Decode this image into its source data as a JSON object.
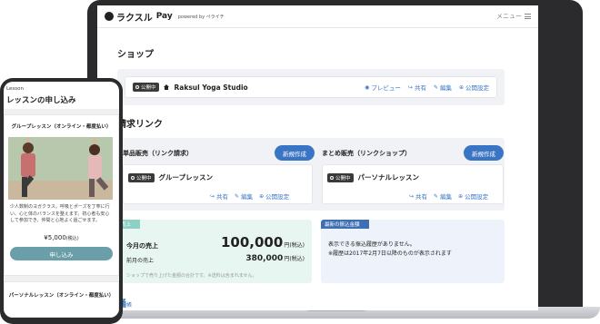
{
  "header": {
    "logo_text": "ラクスル",
    "pay_label": "Pay",
    "powered_label": "powered by ペライチ",
    "menu_label": "メニュー"
  },
  "shop": {
    "section_title": "ショップ",
    "status_badge": "公開中",
    "name": "Raksul Yoga Studio",
    "links": [
      "プレビュー",
      "共有",
      "編集",
      "公開設定"
    ]
  },
  "billing": {
    "section_title": "請求リンク",
    "cards": [
      {
        "title": "単品販売（リンク請求）",
        "new_button": "新規作成",
        "status_badge": "公開中",
        "product": "グループレッスン",
        "links": [
          "共有",
          "編集",
          "公開設定"
        ]
      },
      {
        "title": "まとめ販売（リンクショップ）",
        "new_button": "新規作成",
        "status_badge": "公開中",
        "product": "パーソナルレッスン",
        "links": [
          "共有",
          "編集",
          "公開設定"
        ]
      }
    ]
  },
  "sales": {
    "tag": "売上",
    "current_label": "今月の売上",
    "current_value": "100,000",
    "current_unit": "円(税込)",
    "prev_label": "前月の売上",
    "prev_value": "380,000",
    "prev_unit": "円(税込)",
    "note": "ショップで売り上げた金額の合計です。※送料は含まれません。"
  },
  "deposit": {
    "tag": "最新の振込金額",
    "line1": "表示できる振込履歴がありません。",
    "line2": "※履歴は2017年2月7日以降のものが表示されます"
  },
  "partial_section": {
    "label": "通",
    "small": "帳"
  },
  "phone": {
    "category": "Lesson",
    "title": "レッスンの申し込み",
    "item1_title": "グループレッスン（オンライン・都度払い）",
    "item1_desc": "少人数制のヨガクラス。呼吸とポーズを丁寧に行い、心と体のバランスを整えます。初心者も安心して参加でき、仲間と心地よく過ごせます。",
    "item1_price": "¥5,000",
    "item1_tax": "(税込)",
    "apply_button": "申し込み",
    "item2_title": "パーソナルレッスン（オンライン・都度払い）"
  },
  "colors": {
    "accent_blue": "#3a74c4",
    "sales_green": "#8fd0c4",
    "deposit_blue": "#3f6fb3",
    "apply_teal": "#6a9ea8"
  }
}
